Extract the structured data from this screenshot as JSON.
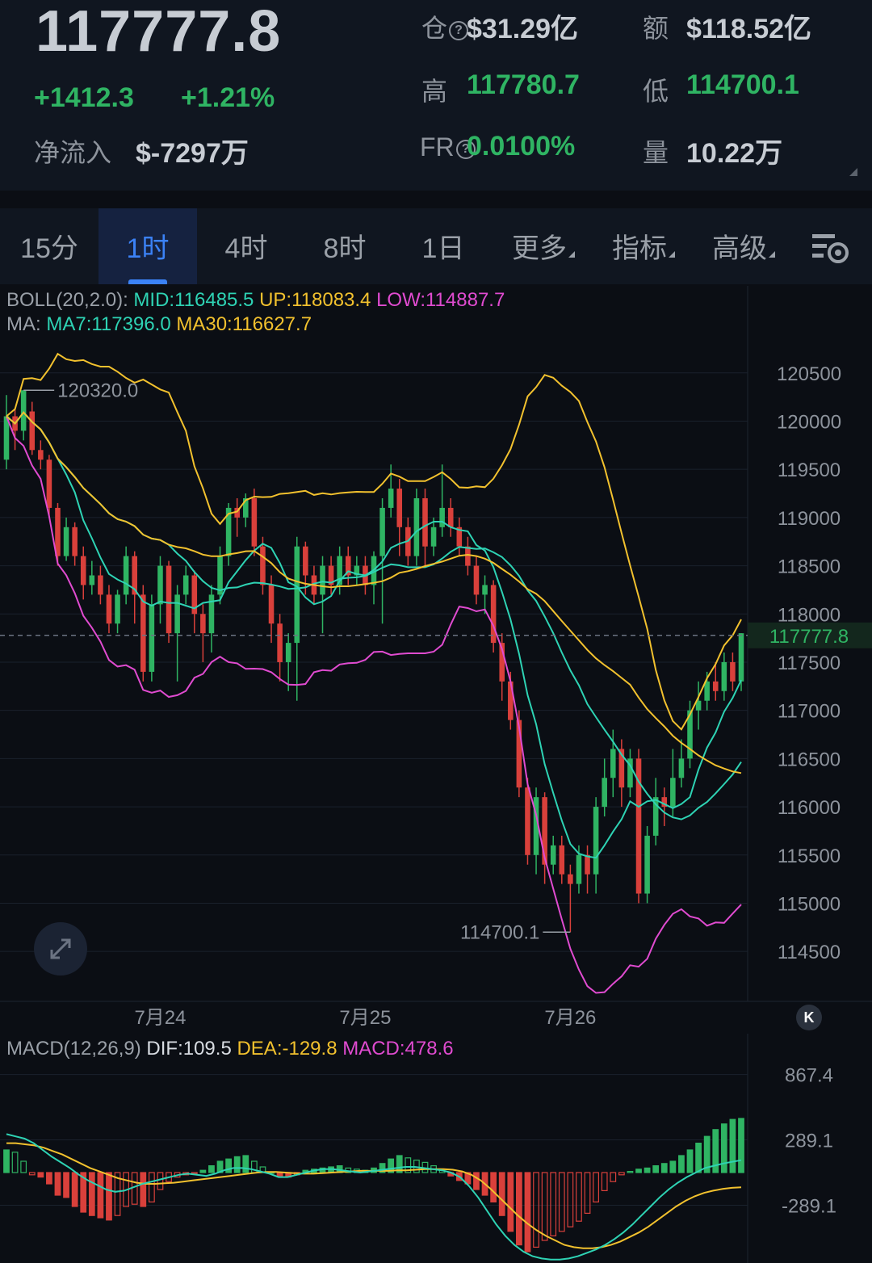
{
  "ticker": {
    "price": "117777.8",
    "change": "+1412.3",
    "change_pct": "+1.21%",
    "net_inflow_label": "净流入",
    "net_inflow_value": "$-7297万",
    "open_interest_label": "仓",
    "open_interest_value": "$31.29亿",
    "turnover_label": "额",
    "turnover_value": "$118.52亿",
    "high_label": "高",
    "high_value": "117780.7",
    "low_label": "低",
    "low_value": "114700.1",
    "fr_label": "FR",
    "fr_value": "0.0100%",
    "volume_label": "量",
    "volume_value": "10.22万"
  },
  "tabs": [
    {
      "label": "15分",
      "active": false
    },
    {
      "label": "1时",
      "active": true
    },
    {
      "label": "4时",
      "active": false
    },
    {
      "label": "8时",
      "active": false
    },
    {
      "label": "1日",
      "active": false
    },
    {
      "label": "更多",
      "active": false,
      "dropdown": true
    },
    {
      "label": "指标",
      "active": false,
      "dropdown": true
    },
    {
      "label": "高级",
      "active": false,
      "dropdown": true
    }
  ],
  "icons": {
    "chart_settings": "chart-settings-icon",
    "expand": "expand-icon",
    "collapse": "chevron-left-icon"
  },
  "indicators": {
    "boll_label": "BOLL(20,2.0):",
    "boll_mid": "MID:116485.5",
    "boll_up": "UP:118083.4",
    "boll_low": "LOW:114887.7",
    "ma_label": "MA:",
    "ma7": "MA7:117396.0",
    "ma30": "MA30:116627.7",
    "macd_label": "MACD(12,26,9)",
    "dif": "DIF:109.5",
    "dea": "DEA:-129.8",
    "macd": "MACD:478.6"
  },
  "colors": {
    "up": "#2fb463",
    "down": "#d9403b",
    "mid": "#2ed3b4",
    "upper": "#f2c12e",
    "lower": "#e04bd0",
    "ma30": "#f2c12e",
    "ma7": "#2ed3b4",
    "accent": "#3b82f6"
  },
  "chart_data": [
    {
      "type": "candlestick",
      "interval": "1时",
      "y_ticks": [
        120500,
        120000,
        119500,
        119000,
        118500,
        118000,
        117500,
        117000,
        116500,
        116000,
        115500,
        115000,
        114500
      ],
      "x_labels": [
        "7月24",
        "7月25",
        "7月26"
      ],
      "ylim": [
        114200,
        120900
      ],
      "last_price": "117777.8",
      "high_marker": "120320.0",
      "low_marker": "114700.1",
      "candles": [
        {
          "o": 119600,
          "c": 120050,
          "h": 120270,
          "l": 119500
        },
        {
          "o": 120050,
          "c": 119900,
          "h": 120120,
          "l": 119700
        },
        {
          "o": 119900,
          "c": 120320,
          "h": 120320,
          "l": 119800
        },
        {
          "o": 120100,
          "c": 119700,
          "h": 120200,
          "l": 119650
        },
        {
          "o": 119700,
          "c": 119600,
          "h": 119800,
          "l": 119500
        },
        {
          "o": 119600,
          "c": 119100,
          "h": 119650,
          "l": 119000
        },
        {
          "o": 119100,
          "c": 118600,
          "h": 119150,
          "l": 118500
        },
        {
          "o": 118600,
          "c": 118900,
          "h": 119000,
          "l": 118550
        },
        {
          "o": 118900,
          "c": 118600,
          "h": 118950,
          "l": 118500
        },
        {
          "o": 118600,
          "c": 118300,
          "h": 118700,
          "l": 118150
        },
        {
          "o": 118300,
          "c": 118400,
          "h": 118550,
          "l": 118200
        },
        {
          "o": 118400,
          "c": 118200,
          "h": 118500,
          "l": 118100
        },
        {
          "o": 118200,
          "c": 117900,
          "h": 118300,
          "l": 117800
        },
        {
          "o": 117900,
          "c": 118200,
          "h": 118250,
          "l": 117800
        },
        {
          "o": 118200,
          "c": 118600,
          "h": 118700,
          "l": 118100
        },
        {
          "o": 118600,
          "c": 118200,
          "h": 118650,
          "l": 117900
        },
        {
          "o": 118200,
          "c": 117400,
          "h": 118300,
          "l": 117300
        },
        {
          "o": 117400,
          "c": 118100,
          "h": 118200,
          "l": 117300
        },
        {
          "o": 118100,
          "c": 118500,
          "h": 118600,
          "l": 117900
        },
        {
          "o": 118500,
          "c": 117800,
          "h": 118550,
          "l": 117700
        },
        {
          "o": 117800,
          "c": 118200,
          "h": 118300,
          "l": 117300
        },
        {
          "o": 118200,
          "c": 118400,
          "h": 118500,
          "l": 118100
        },
        {
          "o": 118400,
          "c": 118000,
          "h": 118450,
          "l": 117800
        },
        {
          "o": 118000,
          "c": 117800,
          "h": 118100,
          "l": 117500
        },
        {
          "o": 117800,
          "c": 118200,
          "h": 118300,
          "l": 117600
        },
        {
          "o": 118200,
          "c": 118600,
          "h": 118700,
          "l": 118100
        },
        {
          "o": 118600,
          "c": 119100,
          "h": 119150,
          "l": 118500
        },
        {
          "o": 119100,
          "c": 119000,
          "h": 119200,
          "l": 118800
        },
        {
          "o": 119000,
          "c": 119200,
          "h": 119250,
          "l": 118900
        },
        {
          "o": 119200,
          "c": 118700,
          "h": 119300,
          "l": 118600
        },
        {
          "o": 118700,
          "c": 118300,
          "h": 118800,
          "l": 118200
        },
        {
          "o": 118300,
          "c": 117900,
          "h": 118400,
          "l": 117700
        },
        {
          "o": 117900,
          "c": 117500,
          "h": 118000,
          "l": 117300
        },
        {
          "o": 117500,
          "c": 117700,
          "h": 117800,
          "l": 117200
        },
        {
          "o": 117700,
          "c": 118700,
          "h": 118800,
          "l": 117100
        },
        {
          "o": 118700,
          "c": 118400,
          "h": 118750,
          "l": 118200
        },
        {
          "o": 118400,
          "c": 118200,
          "h": 118500,
          "l": 118100
        },
        {
          "o": 118200,
          "c": 118500,
          "h": 118600,
          "l": 117800
        },
        {
          "o": 118500,
          "c": 118300,
          "h": 118600,
          "l": 118200
        },
        {
          "o": 118300,
          "c": 118600,
          "h": 118700,
          "l": 118200
        },
        {
          "o": 118600,
          "c": 118400,
          "h": 118700,
          "l": 118300
        },
        {
          "o": 118400,
          "c": 118500,
          "h": 118600,
          "l": 118300
        },
        {
          "o": 118500,
          "c": 118300,
          "h": 118600,
          "l": 118200
        },
        {
          "o": 118300,
          "c": 118600,
          "h": 118650,
          "l": 118100
        },
        {
          "o": 118600,
          "c": 119100,
          "h": 119200,
          "l": 117900
        },
        {
          "o": 119100,
          "c": 119300,
          "h": 119550,
          "l": 119000
        },
        {
          "o": 119300,
          "c": 118900,
          "h": 119400,
          "l": 118600
        },
        {
          "o": 118900,
          "c": 118600,
          "h": 119000,
          "l": 118500
        },
        {
          "o": 118600,
          "c": 119200,
          "h": 119300,
          "l": 118500
        },
        {
          "o": 119200,
          "c": 118700,
          "h": 119300,
          "l": 118500
        },
        {
          "o": 118700,
          "c": 118900,
          "h": 119000,
          "l": 118600
        },
        {
          "o": 118900,
          "c": 119100,
          "h": 119550,
          "l": 118800
        },
        {
          "o": 119100,
          "c": 118900,
          "h": 119200,
          "l": 118800
        },
        {
          "o": 118900,
          "c": 118700,
          "h": 119000,
          "l": 118600
        },
        {
          "o": 118700,
          "c": 118500,
          "h": 118800,
          "l": 118400
        },
        {
          "o": 118500,
          "c": 118200,
          "h": 118600,
          "l": 118100
        },
        {
          "o": 118200,
          "c": 118300,
          "h": 118400,
          "l": 118000
        },
        {
          "o": 118300,
          "c": 117700,
          "h": 118350,
          "l": 117600
        },
        {
          "o": 117700,
          "c": 117300,
          "h": 117800,
          "l": 117100
        },
        {
          "o": 117300,
          "c": 116900,
          "h": 117400,
          "l": 116800
        },
        {
          "o": 116900,
          "c": 116200,
          "h": 117000,
          "l": 116100
        },
        {
          "o": 116200,
          "c": 115500,
          "h": 116300,
          "l": 115400
        },
        {
          "o": 115500,
          "c": 116100,
          "h": 116200,
          "l": 115300
        },
        {
          "o": 116100,
          "c": 115400,
          "h": 116150,
          "l": 115200
        },
        {
          "o": 115400,
          "c": 115600,
          "h": 115700,
          "l": 115300
        },
        {
          "o": 115600,
          "c": 115300,
          "h": 115700,
          "l": 115200
        },
        {
          "o": 115300,
          "c": 115200,
          "h": 115400,
          "l": 114700
        },
        {
          "o": 115200,
          "c": 115500,
          "h": 115600,
          "l": 115100
        },
        {
          "o": 115500,
          "c": 115300,
          "h": 115600,
          "l": 115100
        },
        {
          "o": 115300,
          "c": 116000,
          "h": 116100,
          "l": 115100
        },
        {
          "o": 116000,
          "c": 116300,
          "h": 116500,
          "l": 115900
        },
        {
          "o": 116300,
          "c": 116600,
          "h": 116800,
          "l": 116100
        },
        {
          "o": 116600,
          "c": 116200,
          "h": 116700,
          "l": 116000
        },
        {
          "o": 116200,
          "c": 116500,
          "h": 116600,
          "l": 116100
        },
        {
          "o": 116500,
          "c": 115100,
          "h": 116600,
          "l": 115000
        },
        {
          "o": 115100,
          "c": 115700,
          "h": 115800,
          "l": 115000
        },
        {
          "o": 115700,
          "c": 116100,
          "h": 116300,
          "l": 115600
        },
        {
          "o": 116100,
          "c": 116000,
          "h": 116200,
          "l": 115800
        },
        {
          "o": 116000,
          "c": 116300,
          "h": 116600,
          "l": 115900
        },
        {
          "o": 116300,
          "c": 116500,
          "h": 116700,
          "l": 116200
        },
        {
          "o": 116500,
          "c": 117000,
          "h": 117100,
          "l": 116400
        },
        {
          "o": 117000,
          "c": 117100,
          "h": 117300,
          "l": 116800
        },
        {
          "o": 117100,
          "c": 117300,
          "h": 117400,
          "l": 117000
        },
        {
          "o": 117300,
          "c": 117200,
          "h": 117500,
          "l": 117100
        },
        {
          "o": 117200,
          "c": 117500,
          "h": 117600,
          "l": 117100
        },
        {
          "o": 117500,
          "c": 117300,
          "h": 117600,
          "l": 117200
        },
        {
          "o": 117300,
          "c": 117800,
          "h": 117800,
          "l": 117200
        }
      ]
    },
    {
      "type": "bar",
      "name": "MACD(12,26,9)",
      "y_ticks": [
        867.4,
        289.1,
        -289.1,
        -867.4
      ],
      "ylim": [
        -900,
        900
      ],
      "histogram": [
        200,
        180,
        100,
        -20,
        -40,
        -100,
        -200,
        -220,
        -300,
        -350,
        -380,
        -400,
        -420,
        -380,
        -300,
        -280,
        -300,
        -260,
        -150,
        -80,
        -40,
        -20,
        -10,
        20,
        60,
        100,
        120,
        140,
        150,
        100,
        50,
        0,
        -30,
        -40,
        -20,
        20,
        30,
        40,
        50,
        60,
        40,
        30,
        20,
        40,
        80,
        120,
        150,
        130,
        110,
        90,
        60,
        20,
        -30,
        -70,
        -100,
        -150,
        -200,
        -260,
        -380,
        -520,
        -640,
        -700,
        -660,
        -600,
        -560,
        -520,
        -480,
        -430,
        -360,
        -260,
        -160,
        -80,
        -20,
        10,
        30,
        40,
        60,
        80,
        100,
        150,
        200,
        260,
        320,
        380,
        430,
        470,
        478.6
      ],
      "dif": [
        340,
        320,
        300,
        260,
        200,
        140,
        90,
        40,
        -20,
        -70,
        -110,
        -150,
        -170,
        -160,
        -130,
        -100,
        -80,
        -60,
        -40,
        -20,
        -10,
        -20,
        -30,
        -10,
        20,
        40,
        40,
        30,
        10,
        -10,
        -40,
        -40,
        -20,
        0,
        20,
        30,
        30,
        20,
        10,
        0,
        10,
        20,
        30,
        40,
        50,
        50,
        40,
        30,
        20,
        0,
        -40,
        -120,
        -220,
        -340,
        -460,
        -560,
        -640,
        -700,
        -740,
        -760,
        -770,
        -770,
        -760,
        -740,
        -710,
        -680,
        -640,
        -590,
        -530,
        -460,
        -380,
        -300,
        -220,
        -150,
        -90,
        -40,
        0,
        40,
        60,
        80,
        95,
        109.5
      ],
      "dea": [
        260,
        260,
        250,
        240,
        220,
        190,
        160,
        120,
        80,
        40,
        10,
        -20,
        -50,
        -70,
        -90,
        -100,
        -100,
        -95,
        -90,
        -80,
        -70,
        -60,
        -50,
        -40,
        -30,
        -20,
        -10,
        0,
        5,
        5,
        0,
        -5,
        -10,
        -10,
        -5,
        0,
        5,
        10,
        15,
        15,
        15,
        15,
        20,
        20,
        25,
        30,
        30,
        30,
        25,
        10,
        -20,
        -70,
        -140,
        -220,
        -300,
        -380,
        -450,
        -510,
        -560,
        -600,
        -640,
        -660,
        -670,
        -670,
        -660,
        -640,
        -610,
        -570,
        -530,
        -480,
        -420,
        -360,
        -300,
        -250,
        -210,
        -180,
        -160,
        -145,
        -135,
        -129.8
      ]
    }
  ]
}
